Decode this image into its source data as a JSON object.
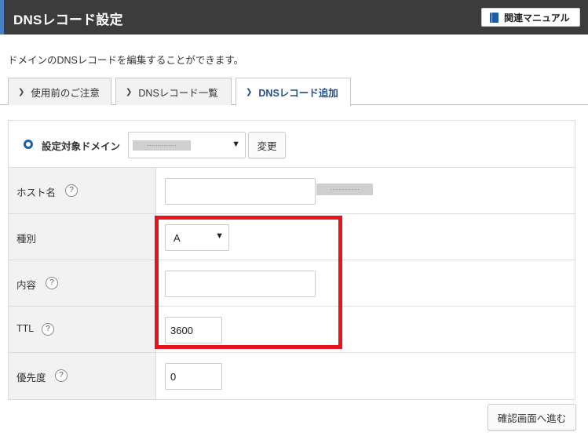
{
  "header": {
    "title": "DNSレコード設定",
    "manual_button": "関連マニュアル",
    "manual_icon": "book-icon"
  },
  "description": "ドメインのDNSレコードを編集することができます。",
  "tabs": [
    {
      "label": "使用前のご注意",
      "active": false
    },
    {
      "label": "DNSレコード一覧",
      "active": false
    },
    {
      "label": "DNSレコード追加",
      "active": true
    }
  ],
  "domain_selector": {
    "label": "設定対象ドメイン",
    "selected_masked": "··············",
    "change_button": "変更"
  },
  "form": {
    "host": {
      "label": "ホスト名",
      "value": "",
      "suffix_masked": "··············"
    },
    "type": {
      "label": "種別",
      "selected": "A"
    },
    "content": {
      "label": "内容",
      "value": ""
    },
    "ttl": {
      "label": "TTL",
      "value": "3600"
    },
    "priority": {
      "label": "優先度",
      "value": "0"
    },
    "help_glyph": "?"
  },
  "confirm_button": "確認画面へ進む",
  "colors": {
    "header_bg": "#3c3c3c",
    "accent_blue": "#1f5fa8",
    "highlight_red": "#e8141d"
  }
}
